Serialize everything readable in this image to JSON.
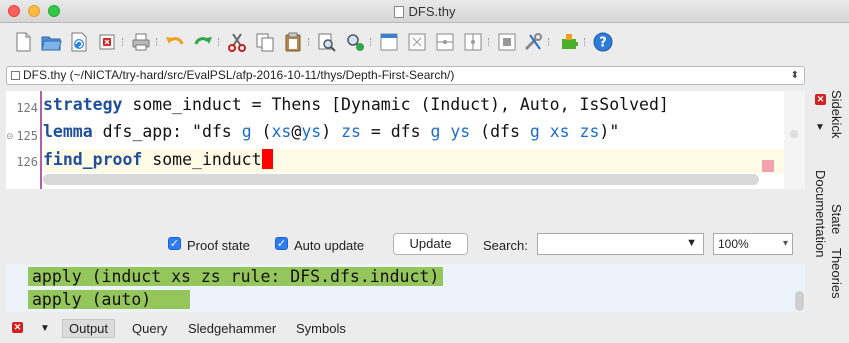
{
  "window": {
    "title": "DFS.thy"
  },
  "toolbar": {
    "icons": [
      "new-file-icon",
      "open-folder-icon",
      "reload-icon",
      "close-buffer-icon",
      "print-icon",
      "undo-icon",
      "redo-icon",
      "cut-icon",
      "copy-icon",
      "paste-icon",
      "find-icon",
      "replace-icon",
      "fullscreen-icon",
      "zoom-icon",
      "split-horizontal-icon",
      "split-vertical-icon",
      "unsplit-icon",
      "tools-icon",
      "plugins-icon",
      "help-icon"
    ]
  },
  "pathbar": {
    "value": "DFS.thy (~/NICTA/try-hard/src/EvalPSL/afp-2016-10-11/thys/Depth-First-Search/)"
  },
  "editor": {
    "lines": [
      {
        "number": "124",
        "keyword": "strategy",
        "rest": " some_induct = Thens [Dynamic (Induct), Auto, IsSolved]"
      },
      {
        "number": "125",
        "keyword": "lemma",
        "rest_a": " dfs_app: \"dfs ",
        "v1": "g",
        "rest_b": " (",
        "v2": "xs",
        "at": "@",
        "v3": "ys",
        "rest_c": ") ",
        "v4": "zs",
        "rest_d": " = dfs ",
        "v5": "g",
        "rest_e": " ",
        "v6": "ys",
        "rest_f": " (dfs ",
        "v7": "g",
        "rest_g": " ",
        "v8": "xs",
        "rest_h": " ",
        "v9": "zs",
        "rest_i": ")\""
      },
      {
        "number": "126",
        "keyword": "find_proof",
        "rest": " some_induct"
      }
    ]
  },
  "controls": {
    "proof_state_label": "Proof state",
    "auto_update_label": "Auto update",
    "update_button": "Update",
    "search_label": "Search:",
    "search_value": "",
    "zoom_value": "100%"
  },
  "output": {
    "lines": [
      "apply (induct xs zs rule: DFS.dfs.induct)",
      "apply (auto)"
    ]
  },
  "bottom_tabs": [
    "Output",
    "Query",
    "Sledgehammer",
    "Symbols"
  ],
  "right_tabs": [
    "Sidekick",
    "State",
    "Theories",
    "Documentation"
  ],
  "colors": {
    "keyword": "#1f4f9c",
    "variable": "#1d6ec8",
    "highlight": "#95c65c",
    "cursor": "#ff0000",
    "error": "#d42020"
  }
}
